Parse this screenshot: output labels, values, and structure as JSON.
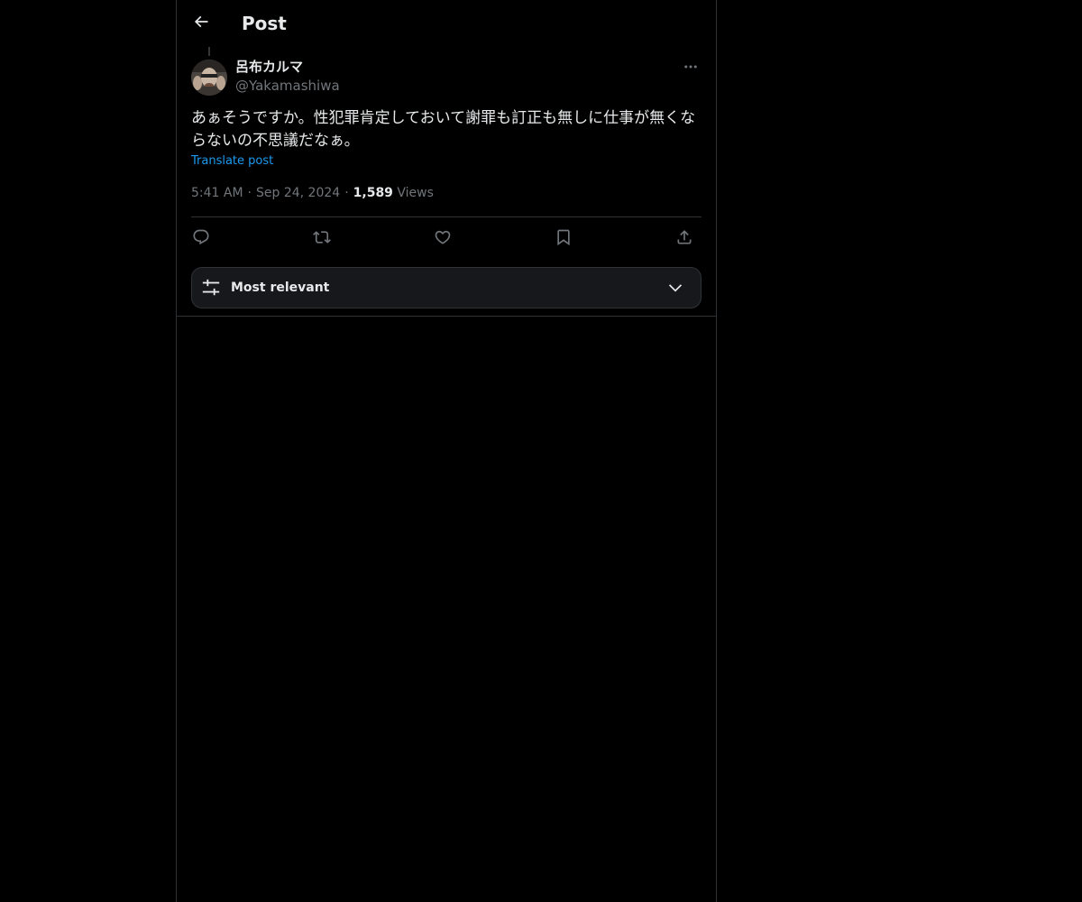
{
  "header": {
    "title": "Post",
    "back_icon": "arrow-left-icon"
  },
  "post": {
    "author_name": "呂布カルマ",
    "author_handle": "@Yakamashiwa",
    "text": "あぁそうですか。性犯罪肯定しておいて謝罪も訂正も無しに仕事が無くならないの不思議だなぁ。",
    "translate_label": "Translate post",
    "time": "5:41 AM",
    "separator": "·",
    "date": "Sep 24, 2024",
    "views_count": "1,589",
    "views_label": "Views",
    "more_icon": "more-horizontal-icon"
  },
  "actions": {
    "items": [
      "reply-icon",
      "repost-icon",
      "like-icon",
      "bookmark-icon",
      "share-icon"
    ]
  },
  "sort": {
    "label": "Most relevant",
    "icon": "sliders-icon",
    "chevron": "chevron-down-icon"
  },
  "colors": {
    "background": "#000000",
    "text_primary": "#e7e9ea",
    "text_secondary": "#71767b",
    "accent": "#1d9bf0",
    "border": "#2f3336",
    "sort_bar_bg": "#16181c"
  }
}
